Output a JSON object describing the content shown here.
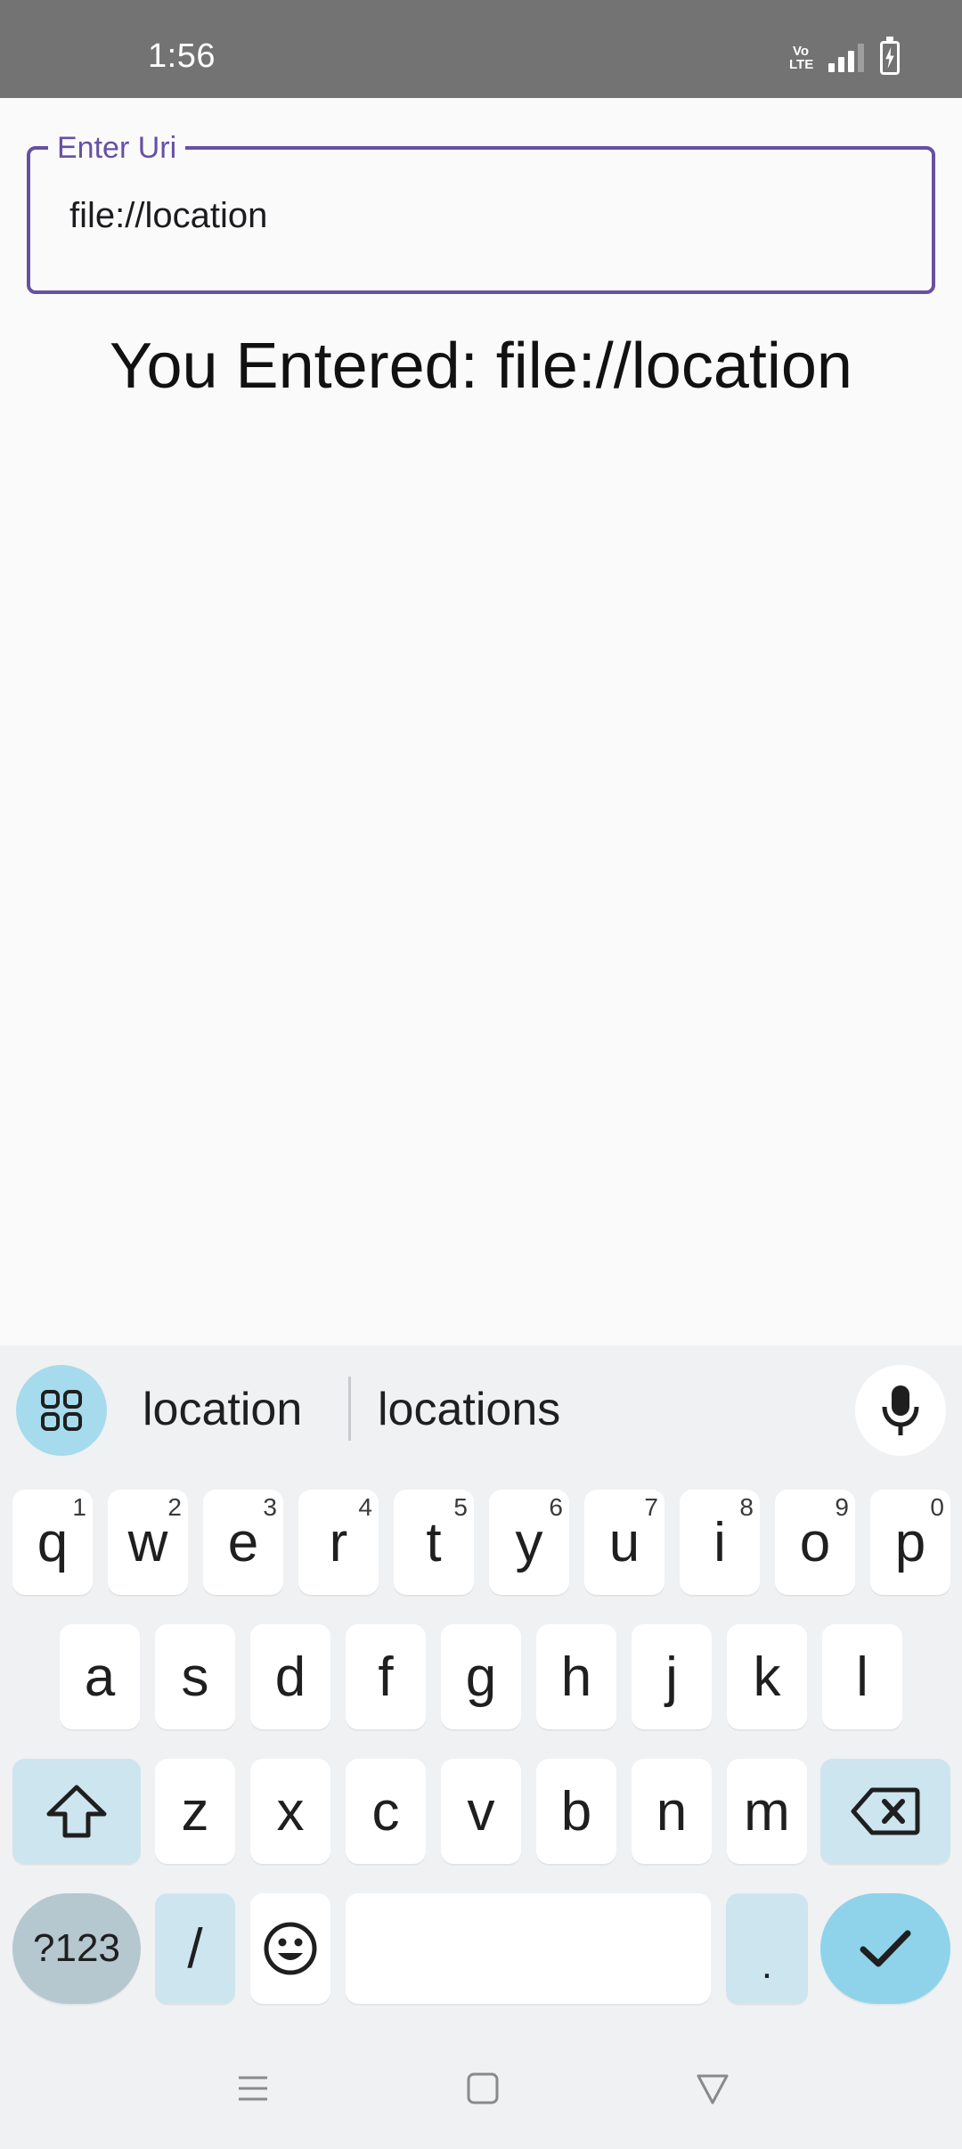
{
  "status_bar": {
    "time": "1:56",
    "network_label": "Vo\nLTE"
  },
  "uri_field": {
    "label": "Enter Uri",
    "value": "file://location"
  },
  "entered_text": "You Entered: file://location",
  "keyboard": {
    "suggestions": [
      "location",
      "locations"
    ],
    "row1": [
      {
        "key": "q",
        "hint": "1"
      },
      {
        "key": "w",
        "hint": "2"
      },
      {
        "key": "e",
        "hint": "3"
      },
      {
        "key": "r",
        "hint": "4"
      },
      {
        "key": "t",
        "hint": "5"
      },
      {
        "key": "y",
        "hint": "6"
      },
      {
        "key": "u",
        "hint": "7"
      },
      {
        "key": "i",
        "hint": "8"
      },
      {
        "key": "o",
        "hint": "9"
      },
      {
        "key": "p",
        "hint": "0"
      }
    ],
    "row2": [
      "a",
      "s",
      "d",
      "f",
      "g",
      "h",
      "j",
      "k",
      "l"
    ],
    "row3": [
      "z",
      "x",
      "c",
      "v",
      "b",
      "n",
      "m"
    ],
    "symbols_label": "?123",
    "slash_label": "/",
    "period_label": "."
  },
  "icons": {
    "apps": "grid-apps-icon",
    "mic": "microphone-icon",
    "shift": "shift-arrow-icon",
    "backspace": "backspace-icon",
    "emoji": "emoji-smiley-icon",
    "enter": "checkmark-icon",
    "nav_recents": "menu-lines-icon",
    "nav_home": "square-home-icon",
    "nav_back": "triangle-back-icon"
  },
  "colors": {
    "accent": "#6750a4",
    "status_bar": "#737373",
    "keyboard_bg": "#eff1f3",
    "enter_key": "#8ed3ea"
  }
}
